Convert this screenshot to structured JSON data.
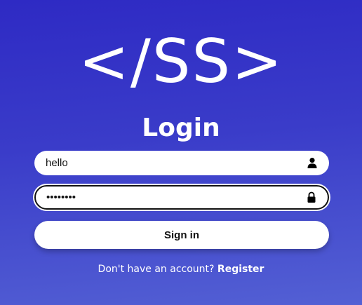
{
  "logo": {
    "text": "</SS>"
  },
  "form": {
    "title": "Login",
    "username": {
      "value": "hello",
      "icon": "user-icon"
    },
    "password": {
      "value": "password",
      "icon": "lock-icon"
    },
    "signin_label": "Sign in"
  },
  "footer": {
    "prompt": "Don't have an account?",
    "register_label": "Register"
  },
  "colors": {
    "background_top": "#2e2ac4",
    "background_bottom": "#5360d4",
    "text": "#ffffff",
    "field": "#ffffff"
  }
}
